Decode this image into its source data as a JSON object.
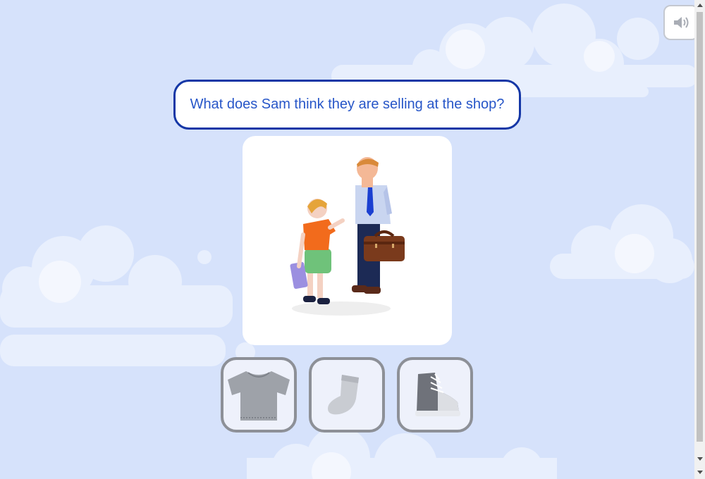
{
  "question": {
    "text": "What does Sam think they are selling at the shop?"
  },
  "sound_button": {
    "icon": "speaker-icon"
  },
  "scene": {
    "illustration": "adult-and-child-talking-illustration"
  },
  "options": [
    {
      "icon": "shirt-icon"
    },
    {
      "icon": "sock-icon"
    },
    {
      "icon": "sneaker-icon"
    }
  ],
  "colors": {
    "background": "#d6e2fb",
    "question_border": "#1537a6",
    "question_text": "#2756c8",
    "option_border": "#8d9097"
  }
}
